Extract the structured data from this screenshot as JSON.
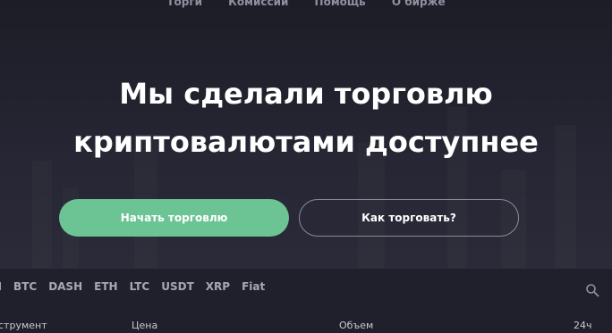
{
  "nav": {
    "items": [
      "Торги",
      "Комиссии",
      "Помощь",
      "О бирже"
    ]
  },
  "hero": {
    "headline_line1": "Мы сделали торговлю",
    "headline_line2": "криптовалютами доступнее",
    "primary_button": "Начать торговлю",
    "secondary_button": "Как торговать?"
  },
  "market": {
    "tabs": [
      "H",
      "BTC",
      "DASH",
      "ETH",
      "LTC",
      "USDT",
      "XRP",
      "Fiat"
    ],
    "columns": {
      "instrument": "струмент",
      "price": "Цена",
      "volume": "Объем",
      "change": "24ч"
    }
  },
  "icons": {
    "search": "search-icon"
  },
  "colors": {
    "accent": "#6cc494",
    "background": "#20202c"
  }
}
